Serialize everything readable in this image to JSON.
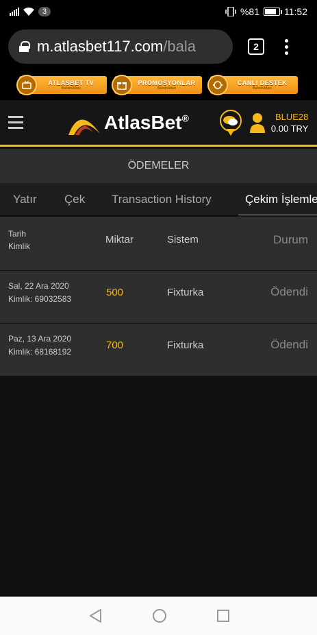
{
  "status_bar": {
    "notification_count": "3",
    "battery": "%81",
    "battery_level": 0.81,
    "time": "11:52"
  },
  "browser": {
    "url_host": "m.atlasbet117.com",
    "url_path": "/bala",
    "tab_count": "2"
  },
  "promos": [
    {
      "title": "ATLASBET TV",
      "sub": "BahsinAtlası",
      "icon": "tv-icon"
    },
    {
      "title": "PROMOSYONLAR",
      "sub": "BahsinAtlası",
      "icon": "gift-icon"
    },
    {
      "title": "CANLI DESTEK",
      "sub": "BahsinAtlası",
      "icon": "support-icon"
    }
  ],
  "header": {
    "logo_text": "AtlasBet",
    "logo_reg": "®",
    "username": "BLUE28",
    "balance": "0.00 TRY"
  },
  "page_title": "ÖDEMELER",
  "tabs": [
    {
      "label": "Yatır",
      "active": false
    },
    {
      "label": "Çek",
      "active": false
    },
    {
      "label": "Transaction History",
      "active": false
    },
    {
      "label": "Çekim İşlemleri",
      "active": true
    }
  ],
  "table": {
    "headers": {
      "date": "Tarih",
      "id": "Kimlik",
      "amount": "Miktar",
      "system": "Sistem",
      "status": "Durum"
    },
    "rows": [
      {
        "date": "Sal, 22 Ara 2020",
        "id": "Kimlik: 69032583",
        "amount": "500",
        "system": "Fixturka",
        "status": "Ödendi"
      },
      {
        "date": "Paz, 13 Ara 2020",
        "id": "Kimlik: 68168192",
        "amount": "700",
        "system": "Fixturka",
        "status": "Ödendi"
      }
    ]
  },
  "colors": {
    "accent": "#f6b81a",
    "background": "#121212",
    "panel": "#2e2e2e"
  }
}
